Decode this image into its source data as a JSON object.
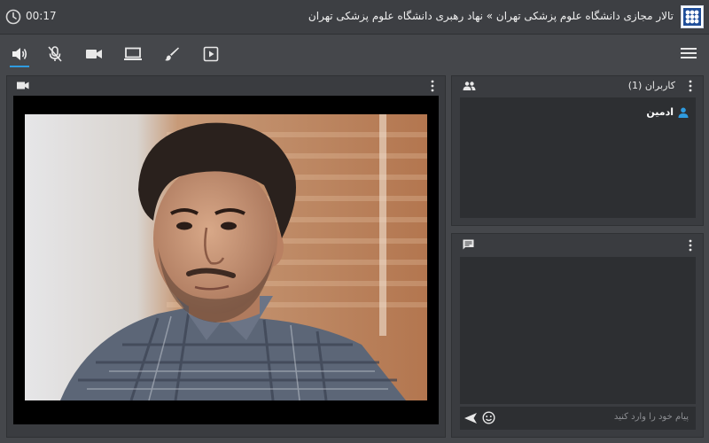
{
  "titlebar": {
    "timer": "00:17",
    "title": "تالار مجازی دانشگاه علوم پزشکی تهران » نهاد رهبری دانشگاه علوم پزشکی تهران",
    "logo_icon": "university-logo"
  },
  "toolbar": {
    "items": [
      {
        "name": "speaker-icon",
        "active": true
      },
      {
        "name": "mic-off-icon",
        "active": false
      },
      {
        "name": "camera-icon",
        "active": false
      },
      {
        "name": "screen-share-icon",
        "active": false
      },
      {
        "name": "brush-icon",
        "active": false
      },
      {
        "name": "play-box-icon",
        "active": false
      }
    ],
    "menu_icon": "hamburger-icon",
    "active_color": "#2f9be0"
  },
  "video_panel": {
    "header_icon": "video-camera-icon"
  },
  "users_panel": {
    "title": "کاربران (1)",
    "header_icon": "users-icon",
    "users": [
      {
        "name": "ادمین",
        "icon": "user-icon",
        "icon_color": "#2f9be0"
      }
    ]
  },
  "chat_panel": {
    "header_icon": "chat-icon",
    "input_placeholder": "پیام خود را وارد کنید",
    "send_icon": "send-icon",
    "emoji_icon": "emoji-icon"
  }
}
